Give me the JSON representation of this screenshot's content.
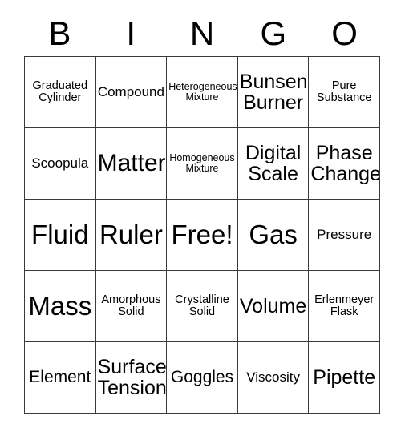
{
  "card": {
    "title": "BINGO",
    "header_letters": [
      "B",
      "I",
      "N",
      "G",
      "O"
    ],
    "rows": 5,
    "columns": 5,
    "border_color": "#3a3a3a",
    "background_color": "#ffffff",
    "text_color": "#000000",
    "cells": [
      [
        {
          "label": "Graduated Cylinder",
          "size": "sm",
          "free": false
        },
        {
          "label": "Compound",
          "size": "md",
          "free": false
        },
        {
          "label": "Heterogeneous Mixture",
          "size": "xs",
          "free": false
        },
        {
          "label": "Bunsen Burner",
          "size": "xl",
          "free": false
        },
        {
          "label": "Pure Substance",
          "size": "sm",
          "free": false
        }
      ],
      [
        {
          "label": "Scoopula",
          "size": "md",
          "free": false
        },
        {
          "label": "Matter",
          "size": "xxl",
          "free": false
        },
        {
          "label": "Homogeneous Mixture",
          "size": "xs",
          "free": false
        },
        {
          "label": "Digital Scale",
          "size": "xl",
          "free": false
        },
        {
          "label": "Phase Change",
          "size": "xl",
          "free": false
        }
      ],
      [
        {
          "label": "Fluid",
          "size": "huge",
          "free": false
        },
        {
          "label": "Ruler",
          "size": "huge",
          "free": false
        },
        {
          "label": "Free!",
          "size": "huge",
          "free": true
        },
        {
          "label": "Gas",
          "size": "huge",
          "free": false
        },
        {
          "label": "Pressure",
          "size": "md",
          "free": false
        }
      ],
      [
        {
          "label": "Mass",
          "size": "huge",
          "free": false
        },
        {
          "label": "Amorphous Solid",
          "size": "sm",
          "free": false
        },
        {
          "label": "Crystalline Solid",
          "size": "sm",
          "free": false
        },
        {
          "label": "Volume",
          "size": "xl",
          "free": false
        },
        {
          "label": "Erlenmeyer Flask",
          "size": "sm",
          "free": false
        }
      ],
      [
        {
          "label": "Element",
          "size": "lg",
          "free": false
        },
        {
          "label": "Surface Tension",
          "size": "xl",
          "free": false
        },
        {
          "label": "Goggles",
          "size": "lg",
          "free": false
        },
        {
          "label": "Viscosity",
          "size": "md",
          "free": false
        },
        {
          "label": "Pipette",
          "size": "xl",
          "free": false
        }
      ]
    ]
  }
}
